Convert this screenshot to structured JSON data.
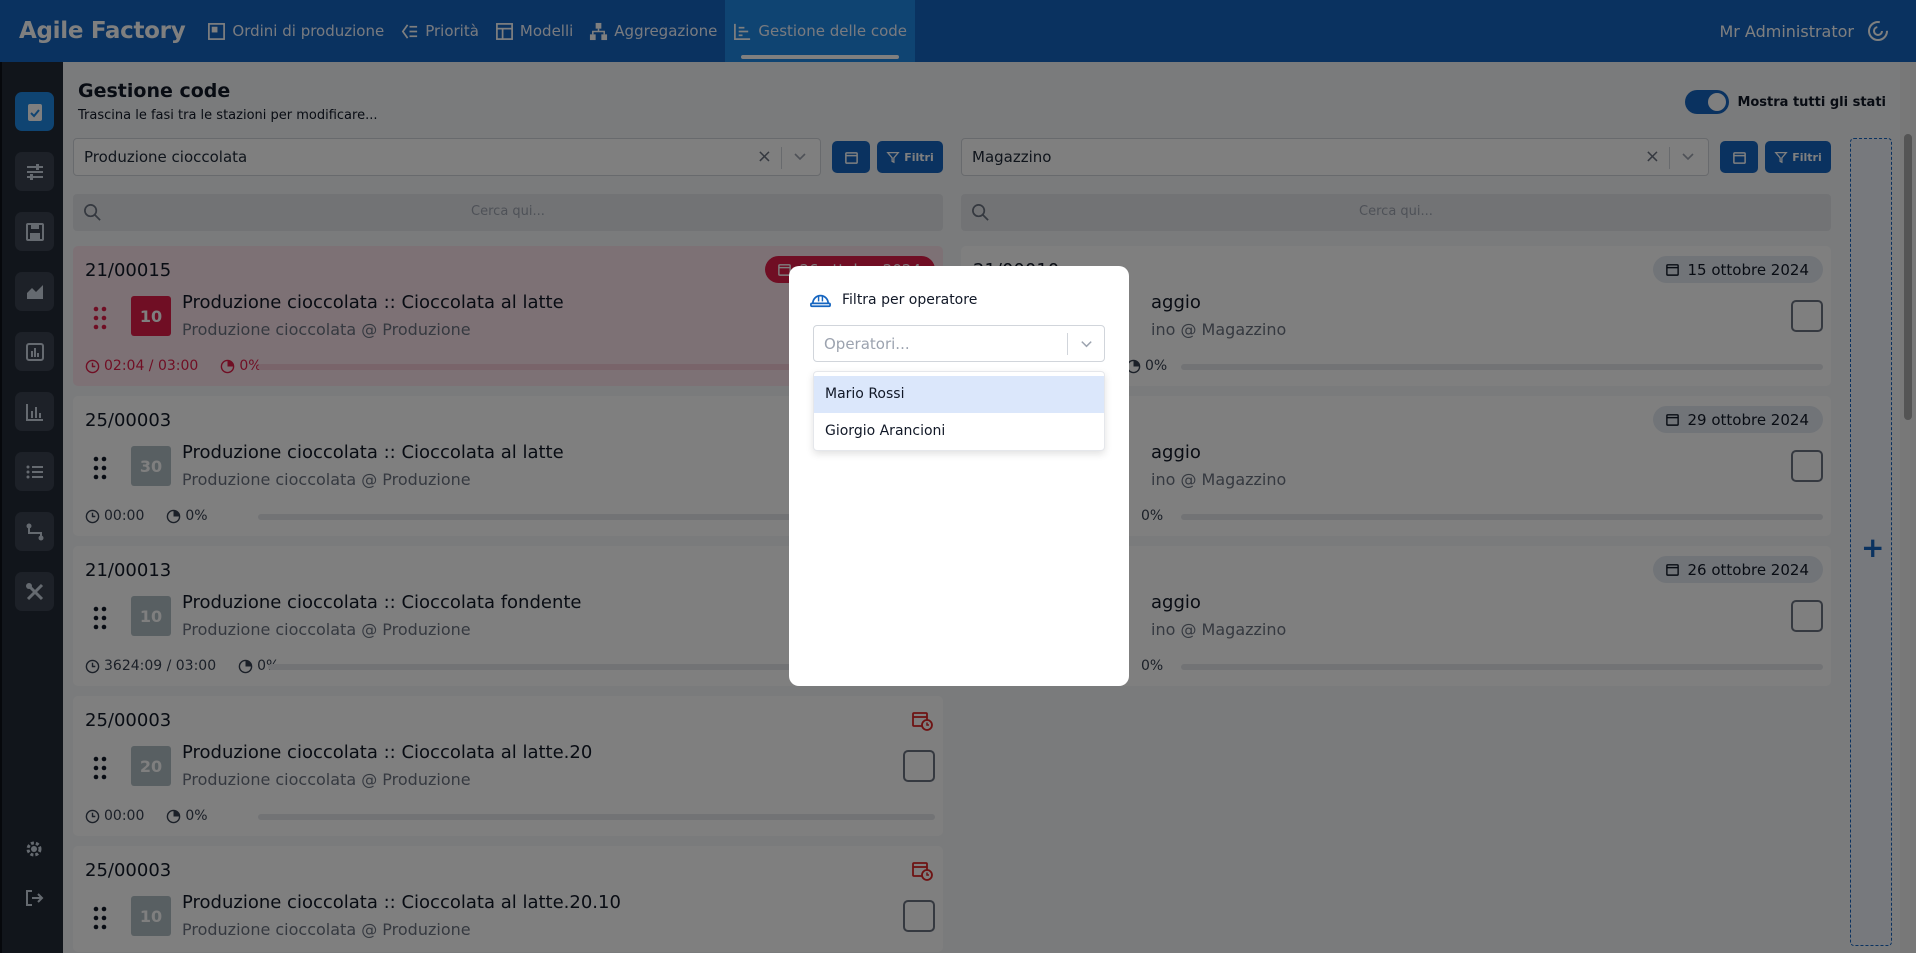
{
  "app": {
    "brand": "Agile Factory",
    "nav": [
      {
        "label": "Ordini di produzione",
        "icon": "orders-icon"
      },
      {
        "label": "Priorità",
        "icon": "priority-icon"
      },
      {
        "label": "Modelli",
        "icon": "models-icon"
      },
      {
        "label": "Aggregazione",
        "icon": "aggregation-icon"
      },
      {
        "label": "Gestione delle code",
        "icon": "queue-icon",
        "active": true
      }
    ],
    "user": "Mr Administrator",
    "accent": "#1565c0"
  },
  "page": {
    "title": "Gestione code",
    "subtitle": "Trascina le fasi tra le stazioni per modificare...",
    "toggle_label": "Mostra tutti gli stati"
  },
  "left": {
    "station": "Produzione cioccolata",
    "filter_label": "Filtri",
    "search_placeholder": "Cerca qui...",
    "cards": [
      {
        "code": "21/00015",
        "qty": "10",
        "title": "Produzione cioccolata :: Cioccolata al latte",
        "subtitle": "Produzione cioccolata @ Produzione",
        "time": "02:04 / 03:00",
        "progress": "0%",
        "date": "26 ottobre 2024",
        "late": true
      },
      {
        "code": "25/00003",
        "qty": "30",
        "title": "Produzione cioccolata :: Cioccolata al latte",
        "subtitle": "Produzione cioccolata @ Produzione",
        "time": "00:00",
        "progress": "0%"
      },
      {
        "code": "21/00013",
        "qty": "10",
        "title": "Produzione cioccolata :: Cioccolata fondente",
        "subtitle": "Produzione cioccolata @ Produzione",
        "time": "3624:09 / 03:00",
        "progress": "0%"
      },
      {
        "code": "25/00003",
        "qty": "20",
        "title": "Produzione cioccolata :: Cioccolata al latte.20",
        "subtitle": "Produzione cioccolata @ Produzione",
        "time": "00:00",
        "progress": "0%"
      },
      {
        "code": "25/00003",
        "qty": "10",
        "title": "Produzione cioccolata :: Cioccolata al latte.20.10",
        "subtitle": "Produzione cioccolata @ Produzione"
      }
    ]
  },
  "right": {
    "station": "Magazzino",
    "filter_label": "Filtri",
    "search_placeholder": "Cerca qui...",
    "cards": [
      {
        "code": "21/00010",
        "title": "aggio",
        "subtitle": "ino @ Magazzino",
        "progress": "0%",
        "date": "15 ottobre 2024"
      },
      {
        "title": "aggio",
        "subtitle": "ino @ Magazzino",
        "progress": "0%",
        "date": "29 ottobre 2024"
      },
      {
        "title": "aggio",
        "subtitle": "ino @ Magazzino",
        "progress": "0%",
        "date": "26 ottobre 2024"
      }
    ]
  },
  "modal": {
    "title": "Filtra per operatore",
    "placeholder": "Operatori...",
    "options": [
      "Mario Rossi",
      "Giorgio Arancioni"
    ]
  }
}
